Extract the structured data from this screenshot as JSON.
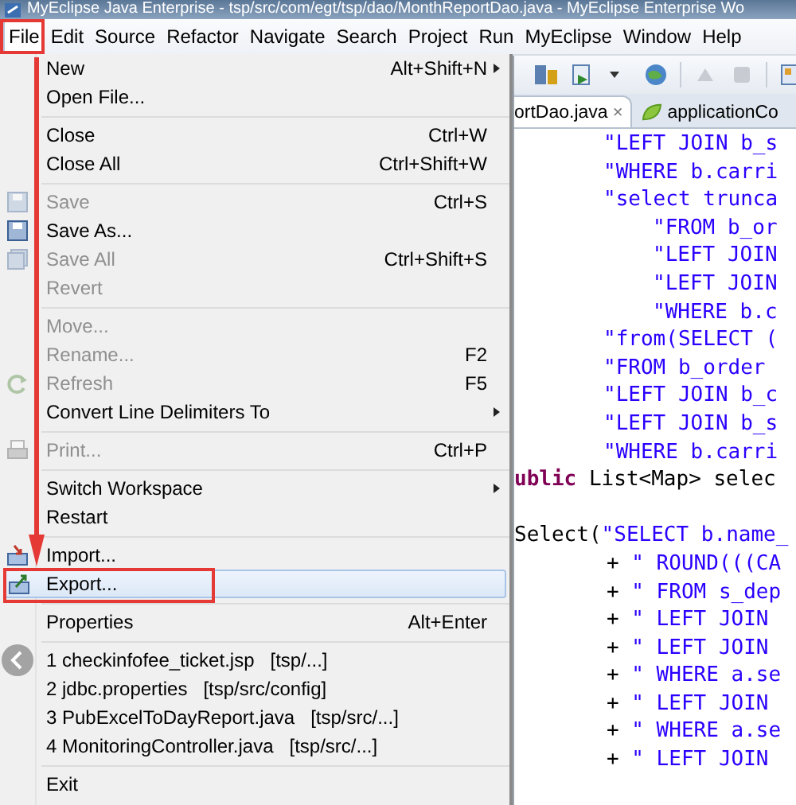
{
  "window": {
    "title": "MyEclipse Java Enterprise - tsp/src/com/egt/tsp/dao/MonthReportDao.java - MyEclipse Enterprise Wo"
  },
  "menubar": [
    {
      "label": "File",
      "selected": true
    },
    {
      "label": "Edit",
      "selected": false
    },
    {
      "label": "Source",
      "selected": false
    },
    {
      "label": "Refactor",
      "selected": false
    },
    {
      "label": "Navigate",
      "selected": false
    },
    {
      "label": "Search",
      "selected": false
    },
    {
      "label": "Project",
      "selected": false
    },
    {
      "label": "Run",
      "selected": false
    },
    {
      "label": "MyEclipse",
      "selected": false
    },
    {
      "label": "Window",
      "selected": false
    },
    {
      "label": "Help",
      "selected": false
    }
  ],
  "file_menu": [
    {
      "kind": "item",
      "label": "New",
      "shortcut": "Alt+Shift+N",
      "submenu": true,
      "disabled": false,
      "selected": false
    },
    {
      "kind": "item",
      "label": "Open File...",
      "disabled": false,
      "selected": false
    },
    {
      "kind": "separator"
    },
    {
      "kind": "item",
      "label": "Close",
      "shortcut": "Ctrl+W",
      "disabled": false,
      "selected": false
    },
    {
      "kind": "item",
      "label": "Close All",
      "shortcut": "Ctrl+Shift+W",
      "disabled": false,
      "selected": false
    },
    {
      "kind": "separator"
    },
    {
      "kind": "item",
      "label": "Save",
      "shortcut": "Ctrl+S",
      "disabled": true,
      "selected": false
    },
    {
      "kind": "item",
      "label": "Save As...",
      "disabled": false,
      "selected": false
    },
    {
      "kind": "item",
      "label": "Save All",
      "shortcut": "Ctrl+Shift+S",
      "disabled": true,
      "selected": false
    },
    {
      "kind": "item",
      "label": "Revert",
      "disabled": true,
      "selected": false
    },
    {
      "kind": "separator"
    },
    {
      "kind": "item",
      "label": "Move...",
      "disabled": true,
      "selected": false
    },
    {
      "kind": "item",
      "label": "Rename...",
      "shortcut": "F2",
      "disabled": true,
      "selected": false
    },
    {
      "kind": "item",
      "label": "Refresh",
      "shortcut": "F5",
      "disabled": true,
      "selected": false
    },
    {
      "kind": "item",
      "label": "Convert Line Delimiters To",
      "submenu": true,
      "disabled": false,
      "selected": false
    },
    {
      "kind": "separator"
    },
    {
      "kind": "item",
      "label": "Print...",
      "shortcut": "Ctrl+P",
      "disabled": true,
      "selected": false
    },
    {
      "kind": "separator"
    },
    {
      "kind": "item",
      "label": "Switch Workspace",
      "submenu": true,
      "disabled": false,
      "selected": false
    },
    {
      "kind": "item",
      "label": "Restart",
      "disabled": false,
      "selected": false
    },
    {
      "kind": "separator"
    },
    {
      "kind": "item",
      "label": "Import...",
      "disabled": false,
      "selected": false
    },
    {
      "kind": "item",
      "label": "Export...",
      "disabled": false,
      "selected": true
    },
    {
      "kind": "separator"
    },
    {
      "kind": "item",
      "label": "Properties",
      "shortcut": "Alt+Enter",
      "disabled": false,
      "selected": false
    },
    {
      "kind": "separator"
    },
    {
      "kind": "recent",
      "label": "1 checkinfofee_ticket.jsp",
      "detail": "[tsp/...]",
      "selected": false
    },
    {
      "kind": "recent",
      "label": "2 jdbc.properties",
      "detail": "[tsp/src/config]",
      "selected": false
    },
    {
      "kind": "recent",
      "label": "3 PubExcelToDayReport.java",
      "detail": "[tsp/src/...]",
      "selected": false
    },
    {
      "kind": "recent",
      "label": "4 MonitoringController.java",
      "detail": "[tsp/src/...]",
      "selected": false
    },
    {
      "kind": "separator"
    },
    {
      "kind": "item",
      "label": "Exit",
      "disabled": false,
      "selected": false
    }
  ],
  "editor_tabs": [
    {
      "label": "ortDao.java",
      "close": "×",
      "selected": true
    },
    {
      "label": "applicationCo",
      "selected": false
    }
  ],
  "code_lines": [
    {
      "kind": "string",
      "segments": [
        {
          "kind": "string",
          "text": "\"LEFT JOIN b_s"
        }
      ]
    },
    {
      "kind": "string",
      "segments": [
        {
          "kind": "string",
          "text": "\"WHERE b.carri"
        }
      ]
    },
    {
      "kind": "string",
      "segments": [
        {
          "kind": "string",
          "text": "\"select trunca"
        }
      ]
    },
    {
      "kind": "nested",
      "segments": [
        {
          "kind": "string",
          "text": "\"FROM b_or"
        }
      ]
    },
    {
      "kind": "nested",
      "segments": [
        {
          "kind": "string",
          "text": "\"LEFT JOIN"
        }
      ]
    },
    {
      "kind": "nested",
      "segments": [
        {
          "kind": "string",
          "text": "\"LEFT JOIN"
        }
      ]
    },
    {
      "kind": "nested",
      "segments": [
        {
          "kind": "string",
          "text": "\"WHERE b.c"
        }
      ]
    },
    {
      "kind": "string",
      "segments": [
        {
          "kind": "string",
          "text": "\"from(SELECT ("
        }
      ]
    },
    {
      "kind": "string",
      "segments": [
        {
          "kind": "string",
          "text": "\"FROM b_order"
        }
      ]
    },
    {
      "kind": "string",
      "segments": [
        {
          "kind": "string",
          "text": "\"LEFT JOIN b_c"
        }
      ]
    },
    {
      "kind": "string",
      "segments": [
        {
          "kind": "string",
          "text": "\"LEFT JOIN b_s"
        }
      ]
    },
    {
      "kind": "string",
      "segments": [
        {
          "kind": "string",
          "text": "\"WHERE b.carri"
        }
      ]
    },
    {
      "kind": "flush",
      "segments": [
        {
          "kind": "keyword",
          "text": "ublic"
        },
        {
          "kind": "plain",
          "text": " List<Map> selec"
        }
      ]
    },
    {
      "kind": "blank"
    },
    {
      "kind": "flush",
      "segments": [
        {
          "kind": "plain",
          "text": "Select("
        },
        {
          "kind": "string",
          "text": "\"SELECT b.name_"
        }
      ]
    },
    {
      "kind": "concat",
      "segments": [
        {
          "kind": "plain",
          "text": "+ "
        },
        {
          "kind": "string",
          "text": "\" ROUND(((CA"
        }
      ]
    },
    {
      "kind": "concat",
      "segments": [
        {
          "kind": "plain",
          "text": "+ "
        },
        {
          "kind": "string",
          "text": "\" FROM s_dep"
        }
      ]
    },
    {
      "kind": "concat",
      "segments": [
        {
          "kind": "plain",
          "text": "+ "
        },
        {
          "kind": "string",
          "text": "\" LEFT JOIN"
        }
      ]
    },
    {
      "kind": "concat",
      "segments": [
        {
          "kind": "plain",
          "text": "+ "
        },
        {
          "kind": "string",
          "text": "\" LEFT JOIN"
        }
      ]
    },
    {
      "kind": "concat",
      "segments": [
        {
          "kind": "plain",
          "text": "+ "
        },
        {
          "kind": "string",
          "text": "\" WHERE a.se"
        }
      ]
    },
    {
      "kind": "concat",
      "segments": [
        {
          "kind": "plain",
          "text": "+ "
        },
        {
          "kind": "string",
          "text": "\" LEFT JOIN"
        }
      ]
    },
    {
      "kind": "concat",
      "segments": [
        {
          "kind": "plain",
          "text": "+ "
        },
        {
          "kind": "string",
          "text": "\" WHERE a.se"
        }
      ]
    },
    {
      "kind": "concat",
      "segments": [
        {
          "kind": "plain",
          "text": "+ "
        },
        {
          "kind": "string",
          "text": "\" LEFT JOIN"
        }
      ]
    }
  ]
}
